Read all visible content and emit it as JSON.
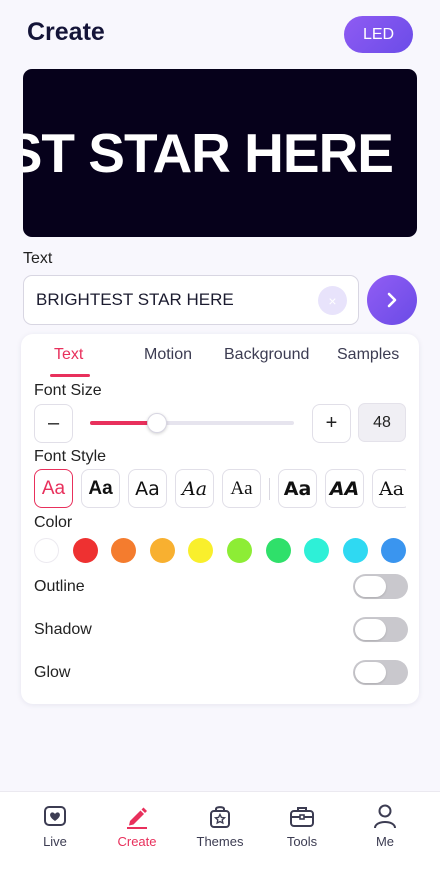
{
  "header": {
    "title": "Create",
    "led_label": "LED"
  },
  "preview": {
    "display_text": "BRIGHTEST STAR HERE",
    "background": "#06011b",
    "text_color": "#ffffff"
  },
  "text_input": {
    "label": "Text",
    "value": "BRIGHTEST STAR HERE",
    "clear_glyph": "×"
  },
  "tabs": [
    {
      "label": "Text",
      "active": true
    },
    {
      "label": "Motion",
      "active": false
    },
    {
      "label": "Background",
      "active": false
    },
    {
      "label": "Samples",
      "active": false
    }
  ],
  "font_size": {
    "label": "Font Size",
    "minus": "–",
    "plus": "+",
    "value": "48",
    "slider_fraction": 0.33
  },
  "font_style": {
    "label": "Font Style",
    "options": [
      {
        "glyph": "Aa",
        "active": true
      },
      {
        "glyph": "Aa",
        "active": false
      },
      {
        "glyph": "Aa",
        "active": false
      },
      {
        "glyph": "Aa",
        "active": false
      },
      {
        "glyph": "Aa",
        "active": false
      },
      {
        "glyph": "Aa",
        "active": false
      },
      {
        "glyph": "AA",
        "active": false
      },
      {
        "glyph": "Aa",
        "active": false
      }
    ]
  },
  "color": {
    "label": "Color",
    "swatches": [
      "#ffffff",
      "#ee3131",
      "#f47c2e",
      "#f8b030",
      "#f9ef2c",
      "#8ded35",
      "#2fe06a",
      "#2ef0d7",
      "#2fd9f2",
      "#3a95ef"
    ]
  },
  "toggles": [
    {
      "label": "Outline",
      "on": false
    },
    {
      "label": "Shadow",
      "on": false
    },
    {
      "label": "Glow",
      "on": false
    }
  ],
  "bottom_nav": [
    {
      "label": "Live",
      "icon": "heart-tv-icon",
      "active": false
    },
    {
      "label": "Create",
      "icon": "pencil-icon",
      "active": true
    },
    {
      "label": "Themes",
      "icon": "bag-star-icon",
      "active": false
    },
    {
      "label": "Tools",
      "icon": "toolbox-icon",
      "active": false
    },
    {
      "label": "Me",
      "icon": "person-icon",
      "active": false
    }
  ],
  "colors": {
    "accent": "#e8305c",
    "primary": "#7a53ee"
  }
}
